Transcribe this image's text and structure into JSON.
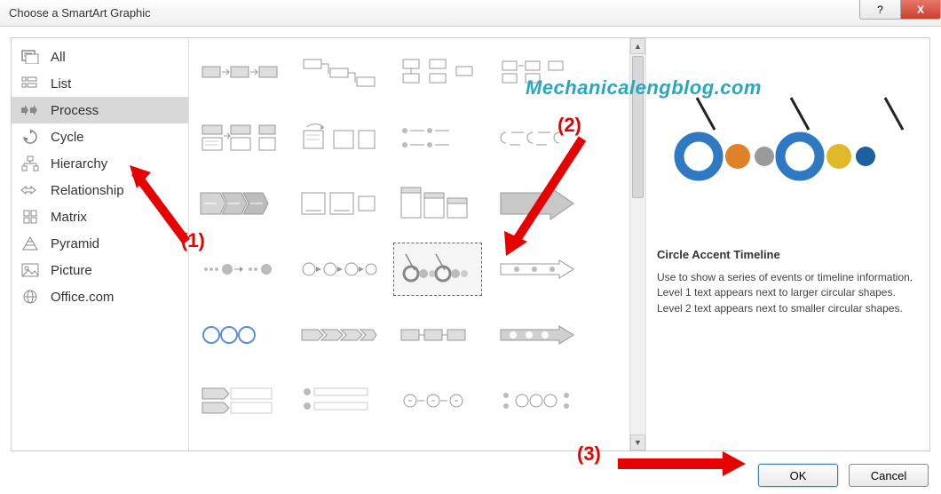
{
  "window": {
    "title": "Choose a SmartArt Graphic"
  },
  "titlebar": {
    "help_symbol": "?",
    "close_symbol": "X"
  },
  "sidebar": {
    "items": [
      {
        "label": "All",
        "name": "all"
      },
      {
        "label": "List",
        "name": "list"
      },
      {
        "label": "Process",
        "name": "process",
        "selected": true
      },
      {
        "label": "Cycle",
        "name": "cycle"
      },
      {
        "label": "Hierarchy",
        "name": "hierarchy"
      },
      {
        "label": "Relationship",
        "name": "relationship"
      },
      {
        "label": "Matrix",
        "name": "matrix"
      },
      {
        "label": "Pyramid",
        "name": "pyramid"
      },
      {
        "label": "Picture",
        "name": "picture"
      },
      {
        "label": "Office.com",
        "name": "officecom"
      }
    ]
  },
  "gallery": {
    "selected_index": 14,
    "items_count": 24
  },
  "preview": {
    "title": "Circle Accent Timeline",
    "description": "Use to show a series of events or timeline information. Level 1 text appears next to larger circular shapes. Level 2 text appears next to smaller circular shapes."
  },
  "buttons": {
    "ok": "OK",
    "cancel": "Cancel"
  },
  "watermark": "Mechanicalengblog.com",
  "annotations": {
    "one": "(1)",
    "two": "(2)",
    "three": "(3)"
  },
  "colors": {
    "accent_blue": "#2f78c2",
    "accent_orange": "#e08127",
    "accent_gray": "#9a9a9a",
    "accent_yellow": "#e0b92b",
    "accent_dkblue": "#1d5fa0"
  }
}
